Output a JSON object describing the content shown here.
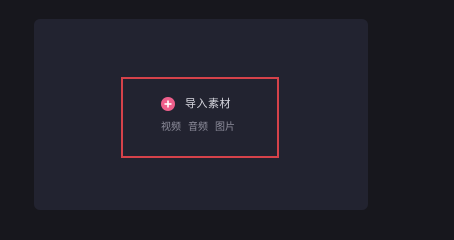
{
  "import_panel": {
    "import_label": "导入素材",
    "icon": "plus-circle-icon",
    "media_types": [
      "视频",
      "音频",
      "图片"
    ]
  },
  "colors": {
    "background": "#17171d",
    "panel": "#222330",
    "highlight_border": "#d6424a",
    "accent": "#ee5f8b"
  }
}
